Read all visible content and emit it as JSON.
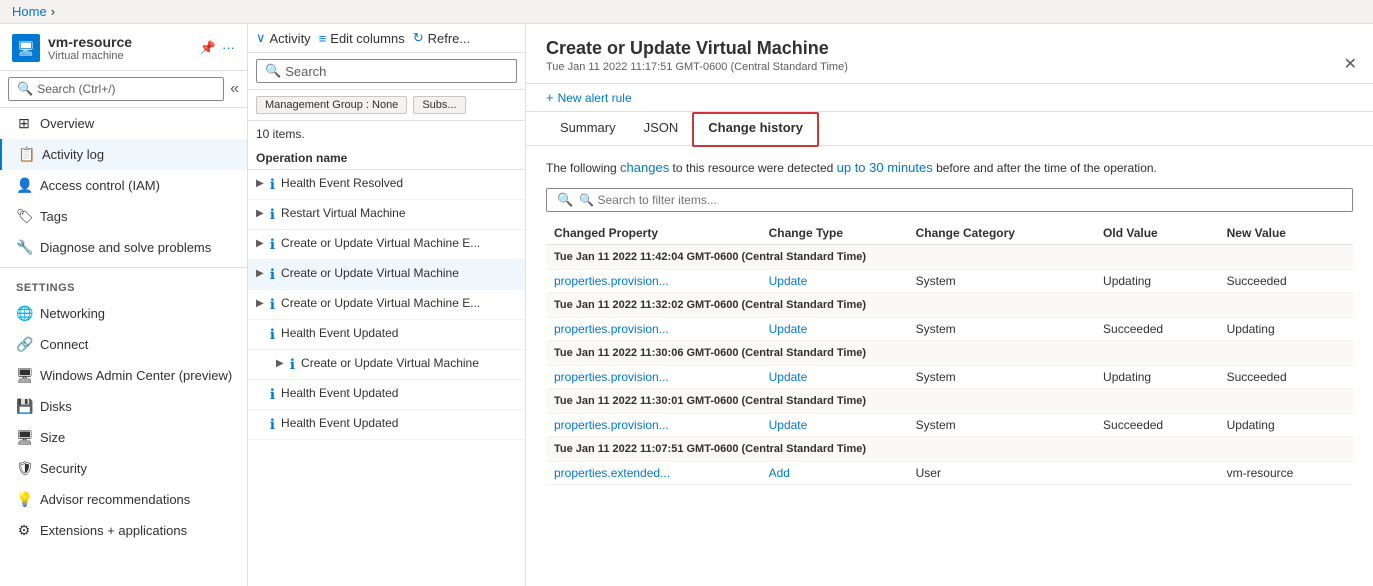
{
  "breadcrumb": {
    "home": "Home",
    "chevron": "›"
  },
  "vm_header": {
    "title": "vm-resource",
    "subtitle": "Virtual machine",
    "page": "Activity log"
  },
  "sidebar": {
    "search_placeholder": "Search (Ctrl+/)",
    "items": [
      {
        "id": "overview",
        "label": "Overview",
        "icon": "⊞"
      },
      {
        "id": "activity-log",
        "label": "Activity log",
        "icon": "🗒",
        "active": true
      },
      {
        "id": "access-control",
        "label": "Access control (IAM)",
        "icon": "👤"
      },
      {
        "id": "tags",
        "label": "Tags",
        "icon": "🏷"
      },
      {
        "id": "diagnose",
        "label": "Diagnose and solve problems",
        "icon": "🔧"
      }
    ],
    "settings_label": "Settings",
    "settings_items": [
      {
        "id": "networking",
        "label": "Networking",
        "icon": "🌐"
      },
      {
        "id": "connect",
        "label": "Connect",
        "icon": "🔗"
      },
      {
        "id": "windows-admin",
        "label": "Windows Admin Center (preview)",
        "icon": "🖥"
      },
      {
        "id": "disks",
        "label": "Disks",
        "icon": "💾"
      },
      {
        "id": "size",
        "label": "Size",
        "icon": "🖥"
      },
      {
        "id": "security",
        "label": "Security",
        "icon": "🛡"
      },
      {
        "id": "advisor",
        "label": "Advisor recommendations",
        "icon": "💡"
      },
      {
        "id": "extensions",
        "label": "Extensions + applications",
        "icon": "⚙"
      }
    ]
  },
  "toolbar": {
    "activity_label": "Activity",
    "edit_columns_label": "Edit columns",
    "refresh_label": "Refre..."
  },
  "log_search_placeholder": "Search",
  "filter_tags": [
    {
      "label": "Management Group : None"
    },
    {
      "label": "Subs..."
    }
  ],
  "items_count": "10 items.",
  "col_operation_name": "Operation name",
  "log_items": [
    {
      "id": 1,
      "label": "Health Event Resolved",
      "expandable": true,
      "indent": false
    },
    {
      "id": 2,
      "label": "Restart Virtual Machine",
      "expandable": true,
      "indent": false
    },
    {
      "id": 3,
      "label": "Create or Update Virtual Machine E...",
      "expandable": true,
      "indent": false
    },
    {
      "id": 4,
      "label": "Create or Update Virtual Machine",
      "expandable": true,
      "indent": false,
      "selected": true
    },
    {
      "id": 5,
      "label": "Create or Update Virtual Machine E...",
      "expandable": true,
      "indent": false
    },
    {
      "id": 6,
      "label": "Health Event Updated",
      "expandable": false,
      "indent": false
    },
    {
      "id": 7,
      "label": "Create or Update Virtual Machine",
      "expandable": true,
      "indent": true
    },
    {
      "id": 8,
      "label": "Health Event Updated",
      "expandable": false,
      "indent": false
    },
    {
      "id": 9,
      "label": "Health Event Updated",
      "expandable": false,
      "indent": false
    }
  ],
  "detail": {
    "title": "Create or Update Virtual Machine",
    "subtitle": "Tue Jan 11 2022 11:17:51 GMT-0600 (Central Standard Time)",
    "new_alert_label": "+ New alert rule",
    "tabs": [
      {
        "id": "summary",
        "label": "Summary",
        "active": false
      },
      {
        "id": "json",
        "label": "JSON",
        "active": false
      },
      {
        "id": "change-history",
        "label": "Change history",
        "active": true,
        "highlighted": true
      }
    ],
    "description": "The following changes to this resource were detected up to 30 minutes before and after the time of the operation.",
    "filter_search_placeholder": "🔍 Search to filter items...",
    "table": {
      "headers": [
        "Changed Property",
        "Change Type",
        "Change Category",
        "Old Value",
        "New Value"
      ],
      "groups": [
        {
          "timestamp": "Tue Jan 11 2022 11:42:04 GMT-0600 (Central Standard Time)",
          "rows": [
            {
              "property": "properties.provision...",
              "type": "Update",
              "category": "System",
              "old": "Updating",
              "new": "Succeeded"
            }
          ]
        },
        {
          "timestamp": "Tue Jan 11 2022 11:32:02 GMT-0600 (Central Standard Time)",
          "rows": [
            {
              "property": "properties.provision...",
              "type": "Update",
              "category": "System",
              "old": "Succeeded",
              "new": "Updating"
            }
          ]
        },
        {
          "timestamp": "Tue Jan 11 2022 11:30:06 GMT-0600 (Central Standard Time)",
          "rows": [
            {
              "property": "properties.provision...",
              "type": "Update",
              "category": "System",
              "old": "Updating",
              "new": "Succeeded"
            }
          ]
        },
        {
          "timestamp": "Tue Jan 11 2022 11:30:01 GMT-0600 (Central Standard Time)",
          "rows": [
            {
              "property": "properties.provision...",
              "type": "Update",
              "category": "System",
              "old": "Succeeded",
              "new": "Updating"
            }
          ]
        },
        {
          "timestamp": "Tue Jan 11 2022 11:07:51 GMT-0600 (Central Standard Time)",
          "rows": [
            {
              "property": "properties.extended...",
              "type": "Add",
              "category": "User",
              "old": "",
              "new": "vm-resource"
            }
          ]
        }
      ]
    }
  }
}
